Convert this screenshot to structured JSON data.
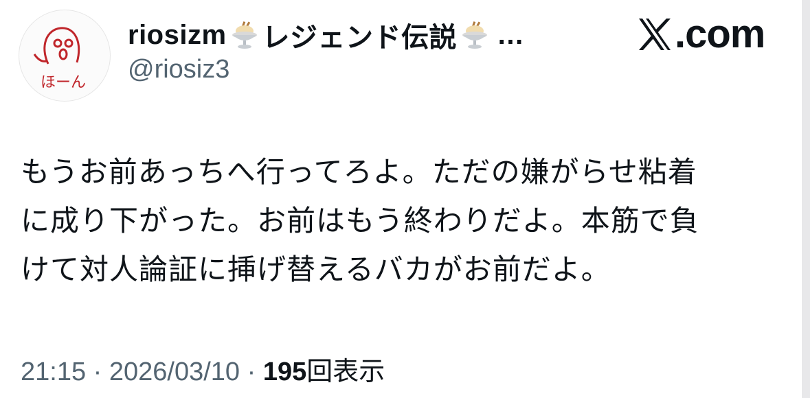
{
  "app": {
    "brand_label": ".com",
    "brand_icon": "x-logo-icon"
  },
  "author": {
    "display_name_part1": "riosizm",
    "display_name_part2": "レジェンド伝説",
    "display_name_truncation": "…",
    "emoji": "ice-cream-sundae-icon",
    "handle": "@riosiz3",
    "avatar_caption": "ほーん"
  },
  "tweet": {
    "text_line1": "もうお前あっちへ行ってろよ。ただの嫌がらせ粘着",
    "text_line2": "に成り下がった。お前はもう終わりだよ。本筋で負",
    "text_line3": "けて対人論証に挿げ替えるバカがお前だよ。"
  },
  "meta": {
    "time": "21:15",
    "separator": "·",
    "date": "2026/03/10",
    "views_count": "195",
    "views_label": "回表示"
  }
}
